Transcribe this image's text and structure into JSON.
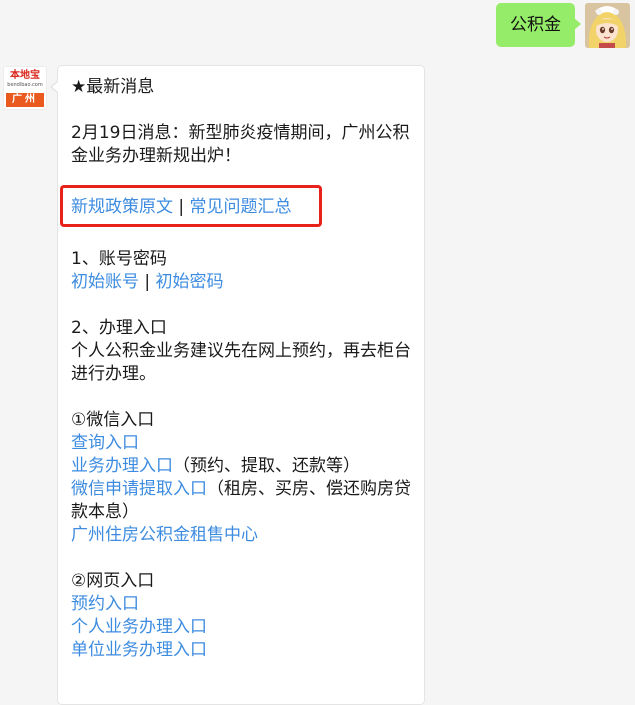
{
  "user_message": {
    "text": "公积金"
  },
  "bot_avatar": {
    "brand": "本地宝",
    "url": "bendibao.com",
    "city": "广州"
  },
  "reply": {
    "headline": "★最新消息",
    "news": "2月19日消息：新型肺炎疫情期间，广州公积金业务办理新规出炉！",
    "policy_link": "新规政策原文",
    "separator": " | ",
    "faq_link": "常见问题汇总",
    "section1_title": "1、账号密码",
    "initial_account_link": "初始账号",
    "initial_password_link": "初始密码",
    "section2_title": "2、办理入口",
    "section2_desc": "个人公积金业务建议先在网上预约，再去柜台进行办理。",
    "wechat_title": "①微信入口",
    "query_link": "查询入口",
    "business_link": "业务办理入口",
    "business_note": "（预约、提取、还款等）",
    "withdraw_link": "微信申请提取入口",
    "withdraw_note": "（租房、买房、偿还购房贷款本息）",
    "rental_center_link": "广州住房公积金租售中心",
    "web_title": "②网页入口",
    "appointment_link": "预约入口",
    "personal_link": "个人业务办理入口",
    "company_link": "单位业务办理入口"
  },
  "colors": {
    "link": "#3d8ce0",
    "user_bubble": "#95ec69",
    "highlight": "#e8221b",
    "background": "#f5f5f5"
  }
}
